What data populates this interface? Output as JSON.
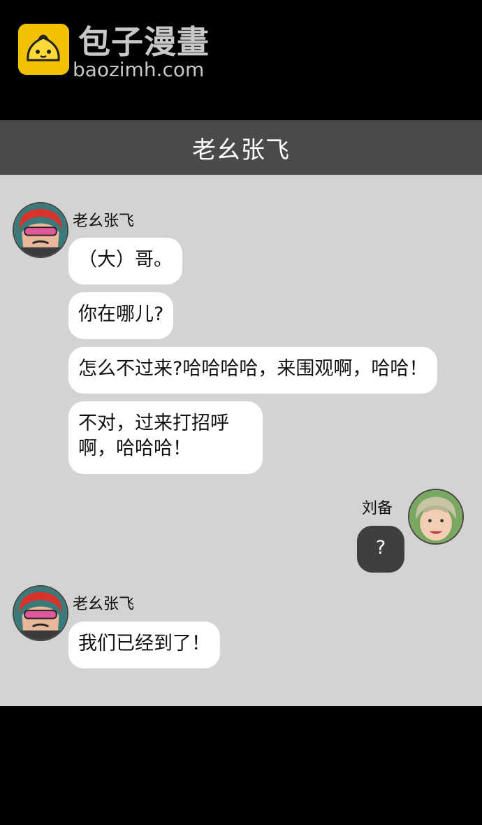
{
  "watermark": {
    "title": "包子漫畫",
    "url": "baozimh.com"
  },
  "chat": {
    "title": "老幺张飞"
  },
  "messages_group1": {
    "sender": "老幺张飞",
    "bubbles": [
      "（大）哥。",
      "你在哪儿?",
      "怎么不过来?哈哈哈哈，来围观啊，哈哈！",
      "不对，过来打招呼",
      "啊，哈哈哈！"
    ]
  },
  "messages_group2": {
    "sender": "刘备",
    "bubbles": [
      "?"
    ]
  },
  "messages_group3": {
    "sender": "老幺张飞",
    "bubbles": [
      "我们已经到了！"
    ]
  },
  "colors": {
    "background": "#000000",
    "header": "#4a4a4a",
    "chat_background": "#d3d3d3",
    "bubble_other": "#ffffff",
    "bubble_self": "#3f3f3f",
    "logo_yellow": "#f2c200"
  },
  "icons": {
    "logo": "bun-face-icon",
    "avatar_zhangfei": "zhangfei-avatar",
    "avatar_liubei": "liubei-avatar"
  }
}
